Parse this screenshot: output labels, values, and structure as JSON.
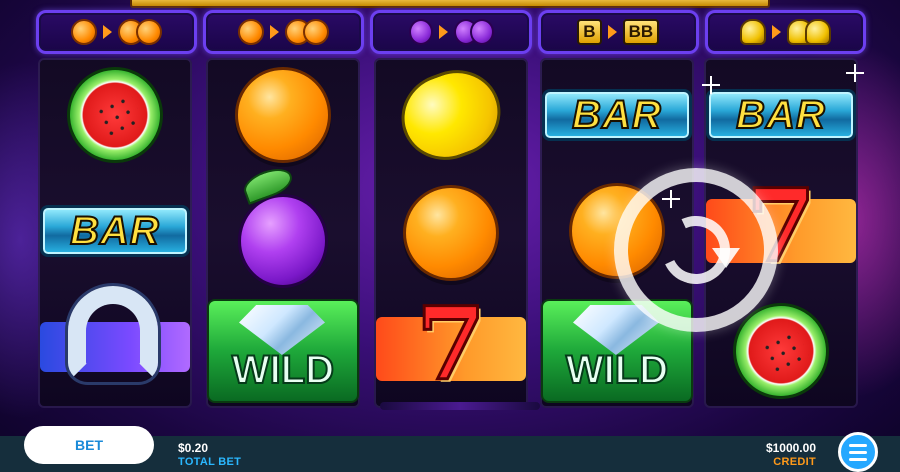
{
  "paytable": [
    {
      "name": "orange",
      "from": "orange-icon",
      "to": "double-orange-icon"
    },
    {
      "name": "orange",
      "from": "orange-icon",
      "to": "double-orange-icon"
    },
    {
      "name": "plum",
      "from": "plum-icon",
      "to": "double-plum-icon"
    },
    {
      "name": "bar",
      "from_text": "B",
      "to_text": "BB"
    },
    {
      "name": "bell",
      "from": "bell-icon",
      "to": "double-bell-icon"
    }
  ],
  "reels": [
    [
      "watermelon",
      "BAR",
      "horseshoe"
    ],
    [
      "orange",
      "plum",
      "WILD"
    ],
    [
      "lemon",
      "orange",
      "7"
    ],
    [
      "BAR",
      "orange",
      "WILD"
    ],
    [
      "BAR",
      "7",
      "watermelon"
    ]
  ],
  "symbols": {
    "bar_label": "BAR",
    "wild_label": "WILD",
    "seven_label": "7"
  },
  "controls": {
    "bet_label": "BET",
    "total_bet_value": "$0.20",
    "total_bet_label": "TOTAL BET",
    "credit_value": "$1000.00",
    "credit_label": "CREDIT",
    "menu_icon": "hamburger-menu-icon",
    "replay_icon": "replay-icon"
  },
  "paytable_labels": {
    "bar_small": "B",
    "bar_double": "BB"
  },
  "colors": {
    "background": "#3a0f78",
    "bottom_bar": "#152e3c",
    "bet_text": "#1a8ad8",
    "total_bet_label": "#2ab8ff",
    "credit_label": "#ff9a1a",
    "menu_button": "#25a8ff"
  }
}
